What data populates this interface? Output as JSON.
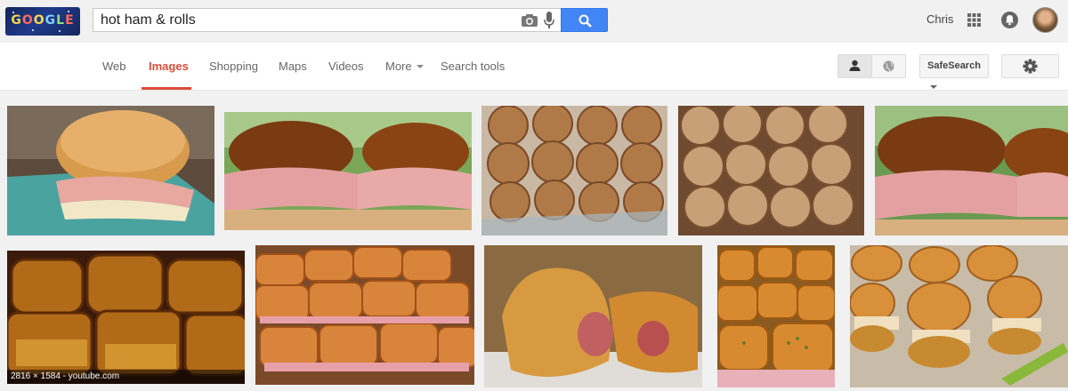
{
  "search": {
    "query": "hot ham & rolls"
  },
  "header": {
    "logo_text": "GOOGLE",
    "user_name": "Chris"
  },
  "nav": {
    "tabs": [
      "Web",
      "Images",
      "Shopping",
      "Maps",
      "Videos",
      "More",
      "Search tools"
    ],
    "active": "Images",
    "safesearch_label": "SafeSearch"
  },
  "results": {
    "hover_caption": "2816 × 1584 - youtube.com",
    "images": [
      {
        "subject": "ham slider on teal plate"
      },
      {
        "subject": "pretzel ham sandwiches outdoors"
      },
      {
        "subject": "ham pinwheel rolls in glass dish"
      },
      {
        "subject": "ham pinwheel rolls baked"
      },
      {
        "subject": "pretzel ham sandwiches outdoors"
      },
      {
        "subject": "glazed ham sliders"
      },
      {
        "subject": "tray of ham sliders"
      },
      {
        "subject": "ham crescent rolls"
      },
      {
        "subject": "ham sliders with seasoning"
      },
      {
        "subject": "ham sliders on baking sheet with brush"
      }
    ]
  },
  "colors": {
    "accent": "#dd4b39",
    "search_button": "#4285f4"
  }
}
